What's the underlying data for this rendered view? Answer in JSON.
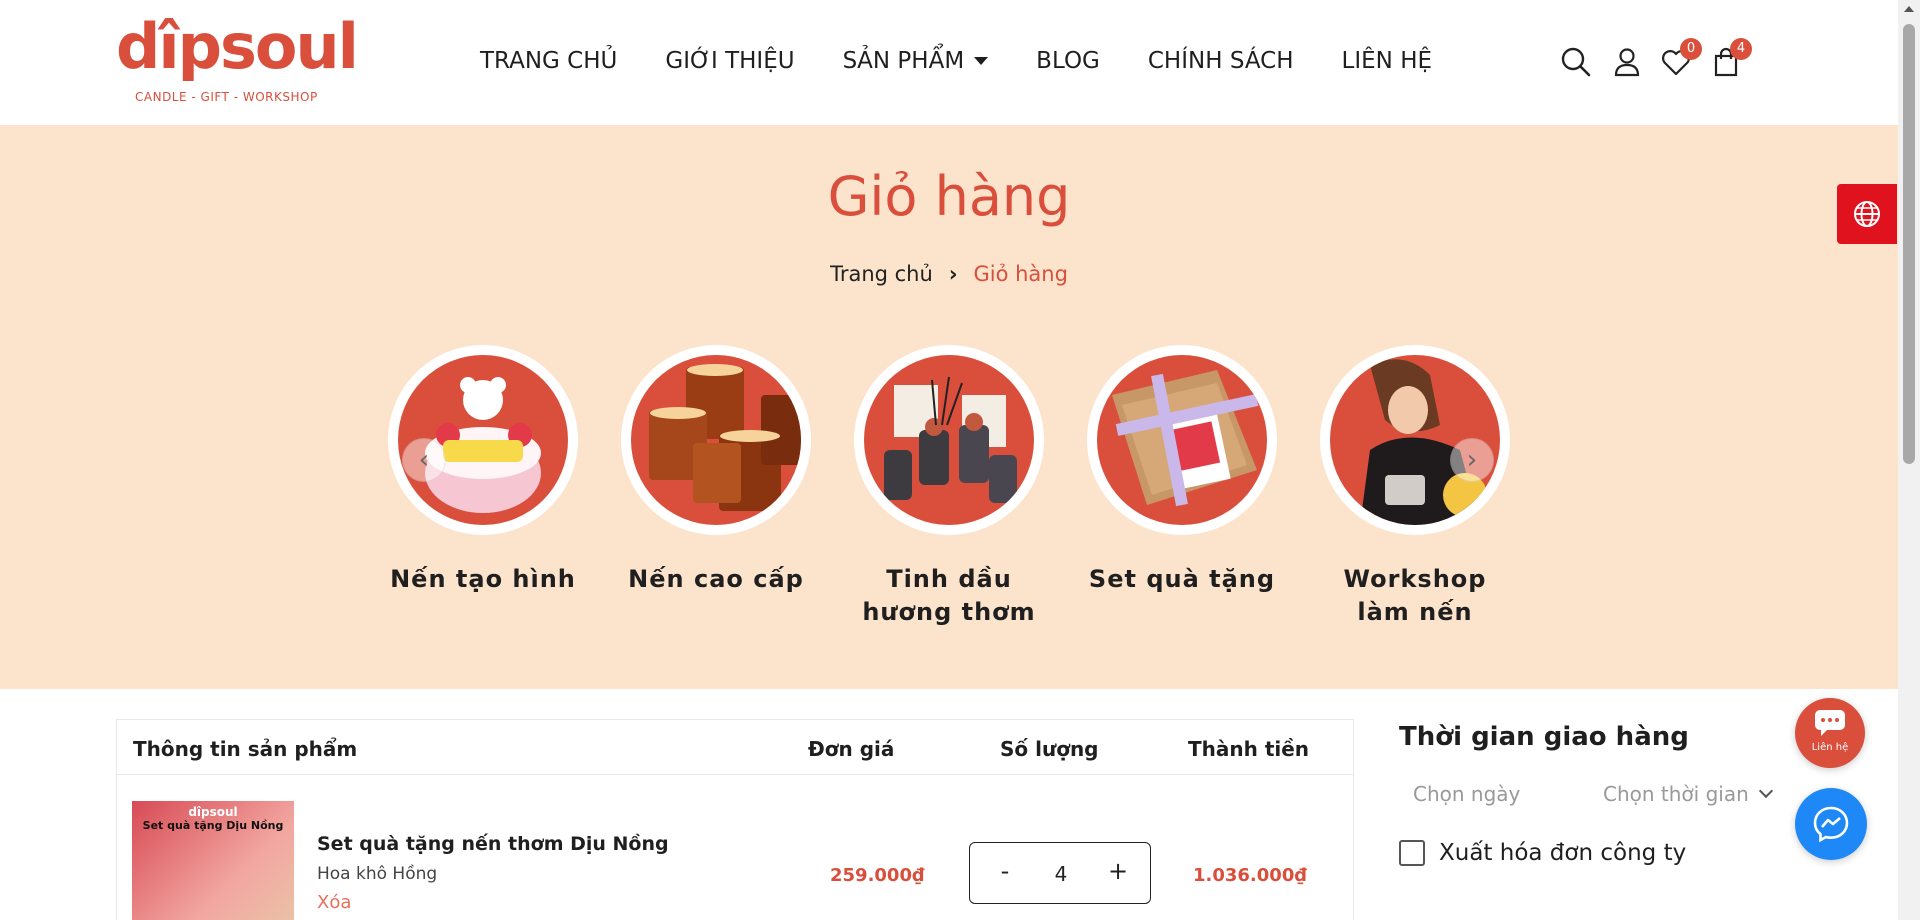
{
  "header": {
    "logo_text": "dîpsoul",
    "logo_tagline": "CANDLE - GIFT - WORKSHOP",
    "nav": [
      {
        "label": "TRANG CHỦ"
      },
      {
        "label": "GIỚI THIỆU"
      },
      {
        "label": "SẢN PHẨM"
      },
      {
        "label": "BLOG"
      },
      {
        "label": "CHÍNH SÁCH"
      },
      {
        "label": "LIÊN HỆ"
      }
    ],
    "wishlist_count": "0",
    "cart_count": "4",
    "icons": [
      "search-icon",
      "user-icon",
      "heart-icon",
      "shopping-bag-icon"
    ]
  },
  "banner": {
    "title": "Giỏ hàng",
    "breadcrumb": {
      "home": "Trang chủ",
      "separator": "›",
      "current": "Giỏ hàng"
    },
    "categories": [
      {
        "label": "Nến tạo hình"
      },
      {
        "label": "Nến cao cấp"
      },
      {
        "label": "Tinh dầu hương thơm"
      },
      {
        "label": "Set quà tặng"
      },
      {
        "label": "Workshop làm nến"
      }
    ],
    "background": "#fce3cc",
    "accent": "#d94f3c"
  },
  "cart": {
    "headers": {
      "product": "Thông tin sản phẩm",
      "price": "Đơn giá",
      "quantity": "Số lượng",
      "total": "Thành tiền"
    },
    "items": [
      {
        "image_brand": "dîpsoul",
        "image_caption": "Set quà tặng Dịu Nồng",
        "name": "Set quà tặng nến thơm Dịu Nồng",
        "variant": "Hoa khô Hồng",
        "remove_label": "Xóa",
        "unit_price": "259.000₫",
        "quantity": "4",
        "minus": "-",
        "plus": "+",
        "line_total": "1.036.000₫"
      }
    ]
  },
  "delivery": {
    "title": "Thời gian giao hàng",
    "date_placeholder": "Chọn ngày",
    "time_placeholder": "Chọn thời gian",
    "invoice_label": "Xuất hóa đơn công ty"
  },
  "widgets": {
    "contact_label": "Liên hệ",
    "contact_color": "#d94f3c",
    "messenger_color": "#1e88f6",
    "language_color": "#e0121d"
  }
}
